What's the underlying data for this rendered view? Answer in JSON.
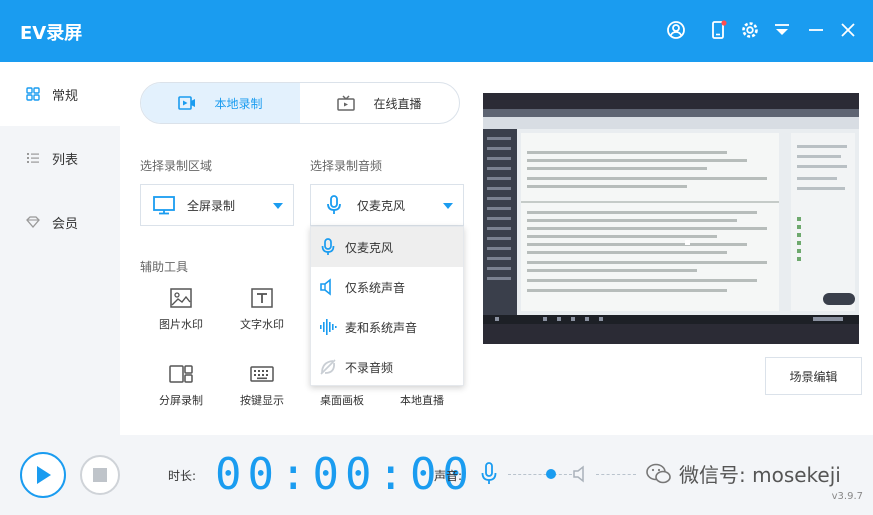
{
  "app": {
    "title": "EV录屏",
    "accent": "#1a9cf0"
  },
  "sidebar": {
    "items": [
      {
        "label": "常规",
        "icon": "grid-icon",
        "active": true
      },
      {
        "label": "列表",
        "icon": "list-icon",
        "active": false
      },
      {
        "label": "会员",
        "icon": "diamond-icon",
        "active": false
      }
    ]
  },
  "tabs": [
    {
      "label": "本地录制",
      "icon": "video-camera-icon",
      "active": true
    },
    {
      "label": "在线直播",
      "icon": "tv-icon",
      "active": false
    }
  ],
  "region": {
    "label": "选择录制区域",
    "value": "全屏录制"
  },
  "audio": {
    "label": "选择录制音频",
    "value": "仅麦克风",
    "options": [
      "仅麦克风",
      "仅系统声音",
      "麦和系统声音",
      "不录音频"
    ],
    "selected_index": 0
  },
  "tools": {
    "label": "辅助工具",
    "items": [
      "图片水印",
      "文字水印",
      "分屏录制",
      "按键显示",
      "桌面画板",
      "本地直播"
    ]
  },
  "scene_button": "场景编辑",
  "bottom": {
    "duration_label": "时长:",
    "timer": "00:00:00",
    "volume_label": "声音:",
    "mic_level": 0.75,
    "watermark_text": "微信号: mosekeji",
    "version": "v3.9.7"
  }
}
